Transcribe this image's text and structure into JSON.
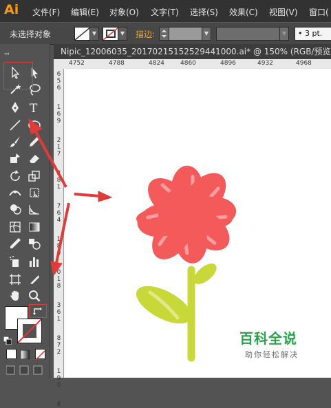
{
  "app": {
    "logo": "Ai"
  },
  "menu": [
    {
      "label": "文件(F)"
    },
    {
      "label": "编辑(E)"
    },
    {
      "label": "对象(O)"
    },
    {
      "label": "文字(T)"
    },
    {
      "label": "选择(S)"
    },
    {
      "label": "效果(C)"
    },
    {
      "label": "视图(V)"
    },
    {
      "label": "窗口("
    }
  ],
  "control_bar": {
    "selection_status": "未选择对象",
    "stroke_label": "描边:",
    "stroke_weight": "• 3 pt."
  },
  "document": {
    "tab_title": "Nipic_12006035_20170215152529441000.ai* @ 150% (RGB/预览)"
  },
  "ruler": {
    "top_ticks": [
      "4752",
      "4788",
      "4824",
      "4860",
      "4896",
      "4932",
      "4968"
    ],
    "left_ticks": [
      "6",
      "5",
      "6",
      "1",
      "6",
      "9",
      "2",
      "1",
      "7",
      "2",
      "8",
      "1",
      "7",
      "6",
      "4",
      "1",
      "8",
      "0",
      "0",
      "1",
      "8",
      "3",
      "6",
      "1",
      "8",
      "7",
      "2",
      "1",
      "9",
      "0",
      "8"
    ]
  },
  "watermark": {
    "title": "百科全说",
    "subtitle": "助你轻松解决"
  },
  "colors": {
    "flower_petal": "#f45a5a",
    "petal_highlight": "#f8a0a0",
    "stem": "#c8d838",
    "annotation": "#e03a3a",
    "ui_dark": "#323232",
    "ui_panel": "#535353"
  }
}
